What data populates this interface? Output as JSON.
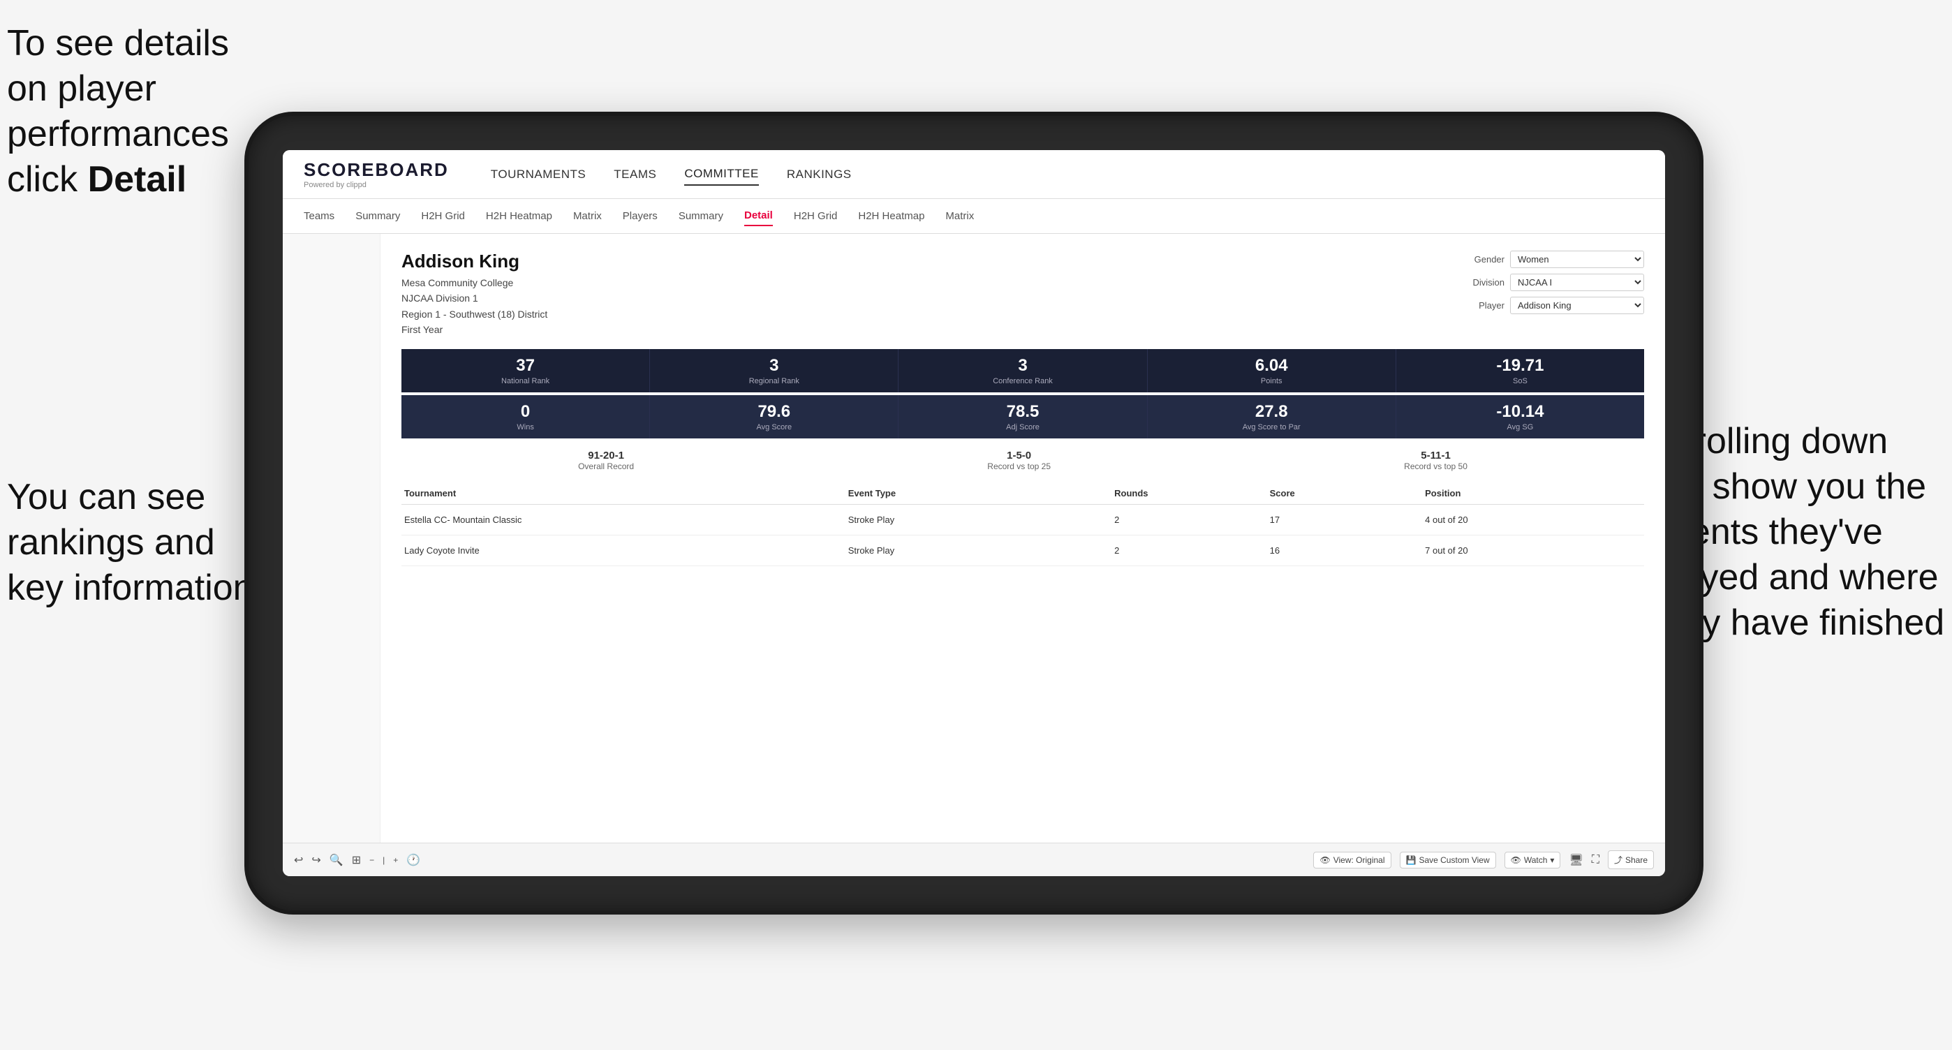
{
  "annotations": {
    "left_top": "To see details on player performances click",
    "left_top_bold": "Detail",
    "left_bottom": "You can see rankings and key information",
    "right": "Scrolling down will show you the events they've played and where they have finished"
  },
  "nav": {
    "logo": "SCOREBOARD",
    "logo_sub": "Powered by clippd",
    "items": [
      "TOURNAMENTS",
      "TEAMS",
      "COMMITTEE",
      "RANKINGS"
    ]
  },
  "sub_nav": {
    "items": [
      "Teams",
      "Summary",
      "H2H Grid",
      "H2H Heatmap",
      "Matrix",
      "Players",
      "Summary",
      "Detail",
      "H2H Grid",
      "H2H Heatmap",
      "Matrix"
    ]
  },
  "player": {
    "name": "Addison King",
    "college": "Mesa Community College",
    "division": "NJCAA Division 1",
    "region": "Region 1 - Southwest (18) District",
    "year": "First Year"
  },
  "controls": {
    "gender_label": "Gender",
    "gender_value": "Women",
    "division_label": "Division",
    "division_value": "NJCAA I",
    "player_label": "Player",
    "player_value": "Addison King"
  },
  "stats_row1": [
    {
      "value": "37",
      "label": "National Rank"
    },
    {
      "value": "3",
      "label": "Regional Rank"
    },
    {
      "value": "3",
      "label": "Conference Rank"
    },
    {
      "value": "6.04",
      "label": "Points"
    },
    {
      "value": "-19.71",
      "label": "SoS"
    }
  ],
  "stats_row2": [
    {
      "value": "0",
      "label": "Wins"
    },
    {
      "value": "79.6",
      "label": "Avg Score"
    },
    {
      "value": "78.5",
      "label": "Adj Score"
    },
    {
      "value": "27.8",
      "label": "Avg Score to Par"
    },
    {
      "value": "-10.14",
      "label": "Avg SG"
    }
  ],
  "records": [
    {
      "value": "91-20-1",
      "label": "Overall Record"
    },
    {
      "value": "1-5-0",
      "label": "Record vs top 25"
    },
    {
      "value": "5-11-1",
      "label": "Record vs top 50"
    }
  ],
  "table": {
    "headers": [
      "Tournament",
      "Event Type",
      "Rounds",
      "Score",
      "Position"
    ],
    "rows": [
      {
        "tournament": "Estella CC- Mountain Classic",
        "event_type": "Stroke Play",
        "rounds": "2",
        "score": "17",
        "position": "4 out of 20"
      },
      {
        "tournament": "Lady Coyote Invite",
        "event_type": "Stroke Play",
        "rounds": "2",
        "score": "16",
        "position": "7 out of 20"
      }
    ]
  },
  "toolbar": {
    "buttons": [
      "View: Original",
      "Save Custom View",
      "Watch",
      "Share"
    ]
  }
}
